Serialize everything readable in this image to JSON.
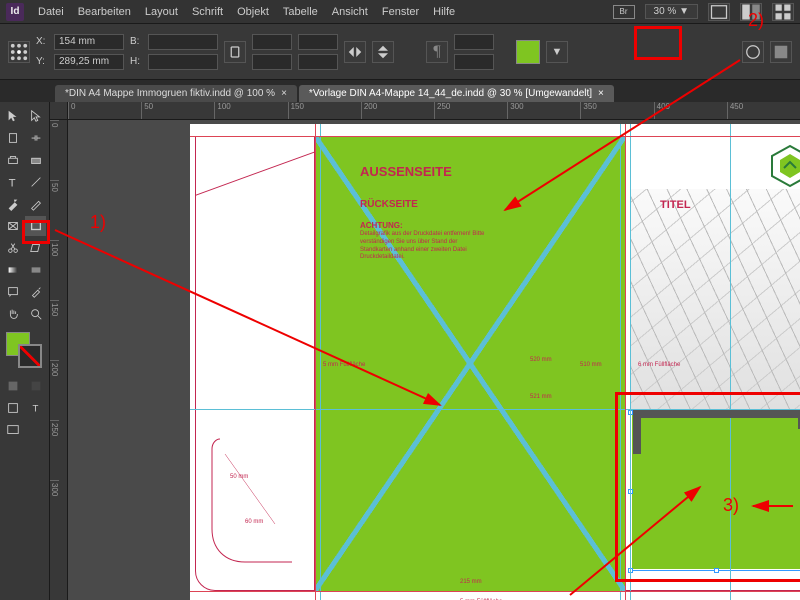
{
  "menu": {
    "items": [
      "Datei",
      "Bearbeiten",
      "Layout",
      "Schrift",
      "Objekt",
      "Tabelle",
      "Ansicht",
      "Fenster",
      "Hilfe"
    ],
    "br_label": "Br",
    "zoom": "30 %"
  },
  "controlbar": {
    "x_label": "X:",
    "x_value": "154 mm",
    "y_label": "Y:",
    "y_value": "289,25 mm",
    "w_label": "B:",
    "w_value": "",
    "h_label": "H:",
    "h_value": "",
    "fill_color": "#7fc521"
  },
  "tabs": [
    {
      "label": "*DIN A4 Mappe Immogruen fiktiv.indd @ 100 %",
      "active": false
    },
    {
      "label": "*Vorlage DIN A4-Mappe 14_44_de.indd @ 30 % [Umgewandelt]",
      "active": true
    }
  ],
  "ruler_h": [
    "0",
    "50",
    "100",
    "150",
    "200",
    "250",
    "300",
    "350",
    "400",
    "450"
  ],
  "ruler_v": [
    "0",
    "50",
    "100",
    "150",
    "200",
    "250",
    "300"
  ],
  "document": {
    "heading1": "AUSSENSEITE",
    "heading2": "RÜCKSEITE",
    "warning_title": "ACHTUNG:",
    "warning_body": "Detailgrafik aus der Druckdatei entfernen! Bitte verständigen Sie uns über Stand der Standkarten anhand einer zweiten Datei Druckdetaildatei.",
    "titel": "TITEL",
    "dim_5mm": "5 mm Füllfläche",
    "dim_520": "520 mm",
    "dim_521": "521 mm",
    "dim_510": "510 mm",
    "dim_215": "215 mm",
    "dim_50": "50 mm",
    "dim_60": "60 mm",
    "dim_6mm": "6 mm Füllfläche"
  },
  "annotations": {
    "label1": "1)",
    "label2": "2)",
    "label3": "3)"
  },
  "icons": {
    "app": "Id"
  }
}
